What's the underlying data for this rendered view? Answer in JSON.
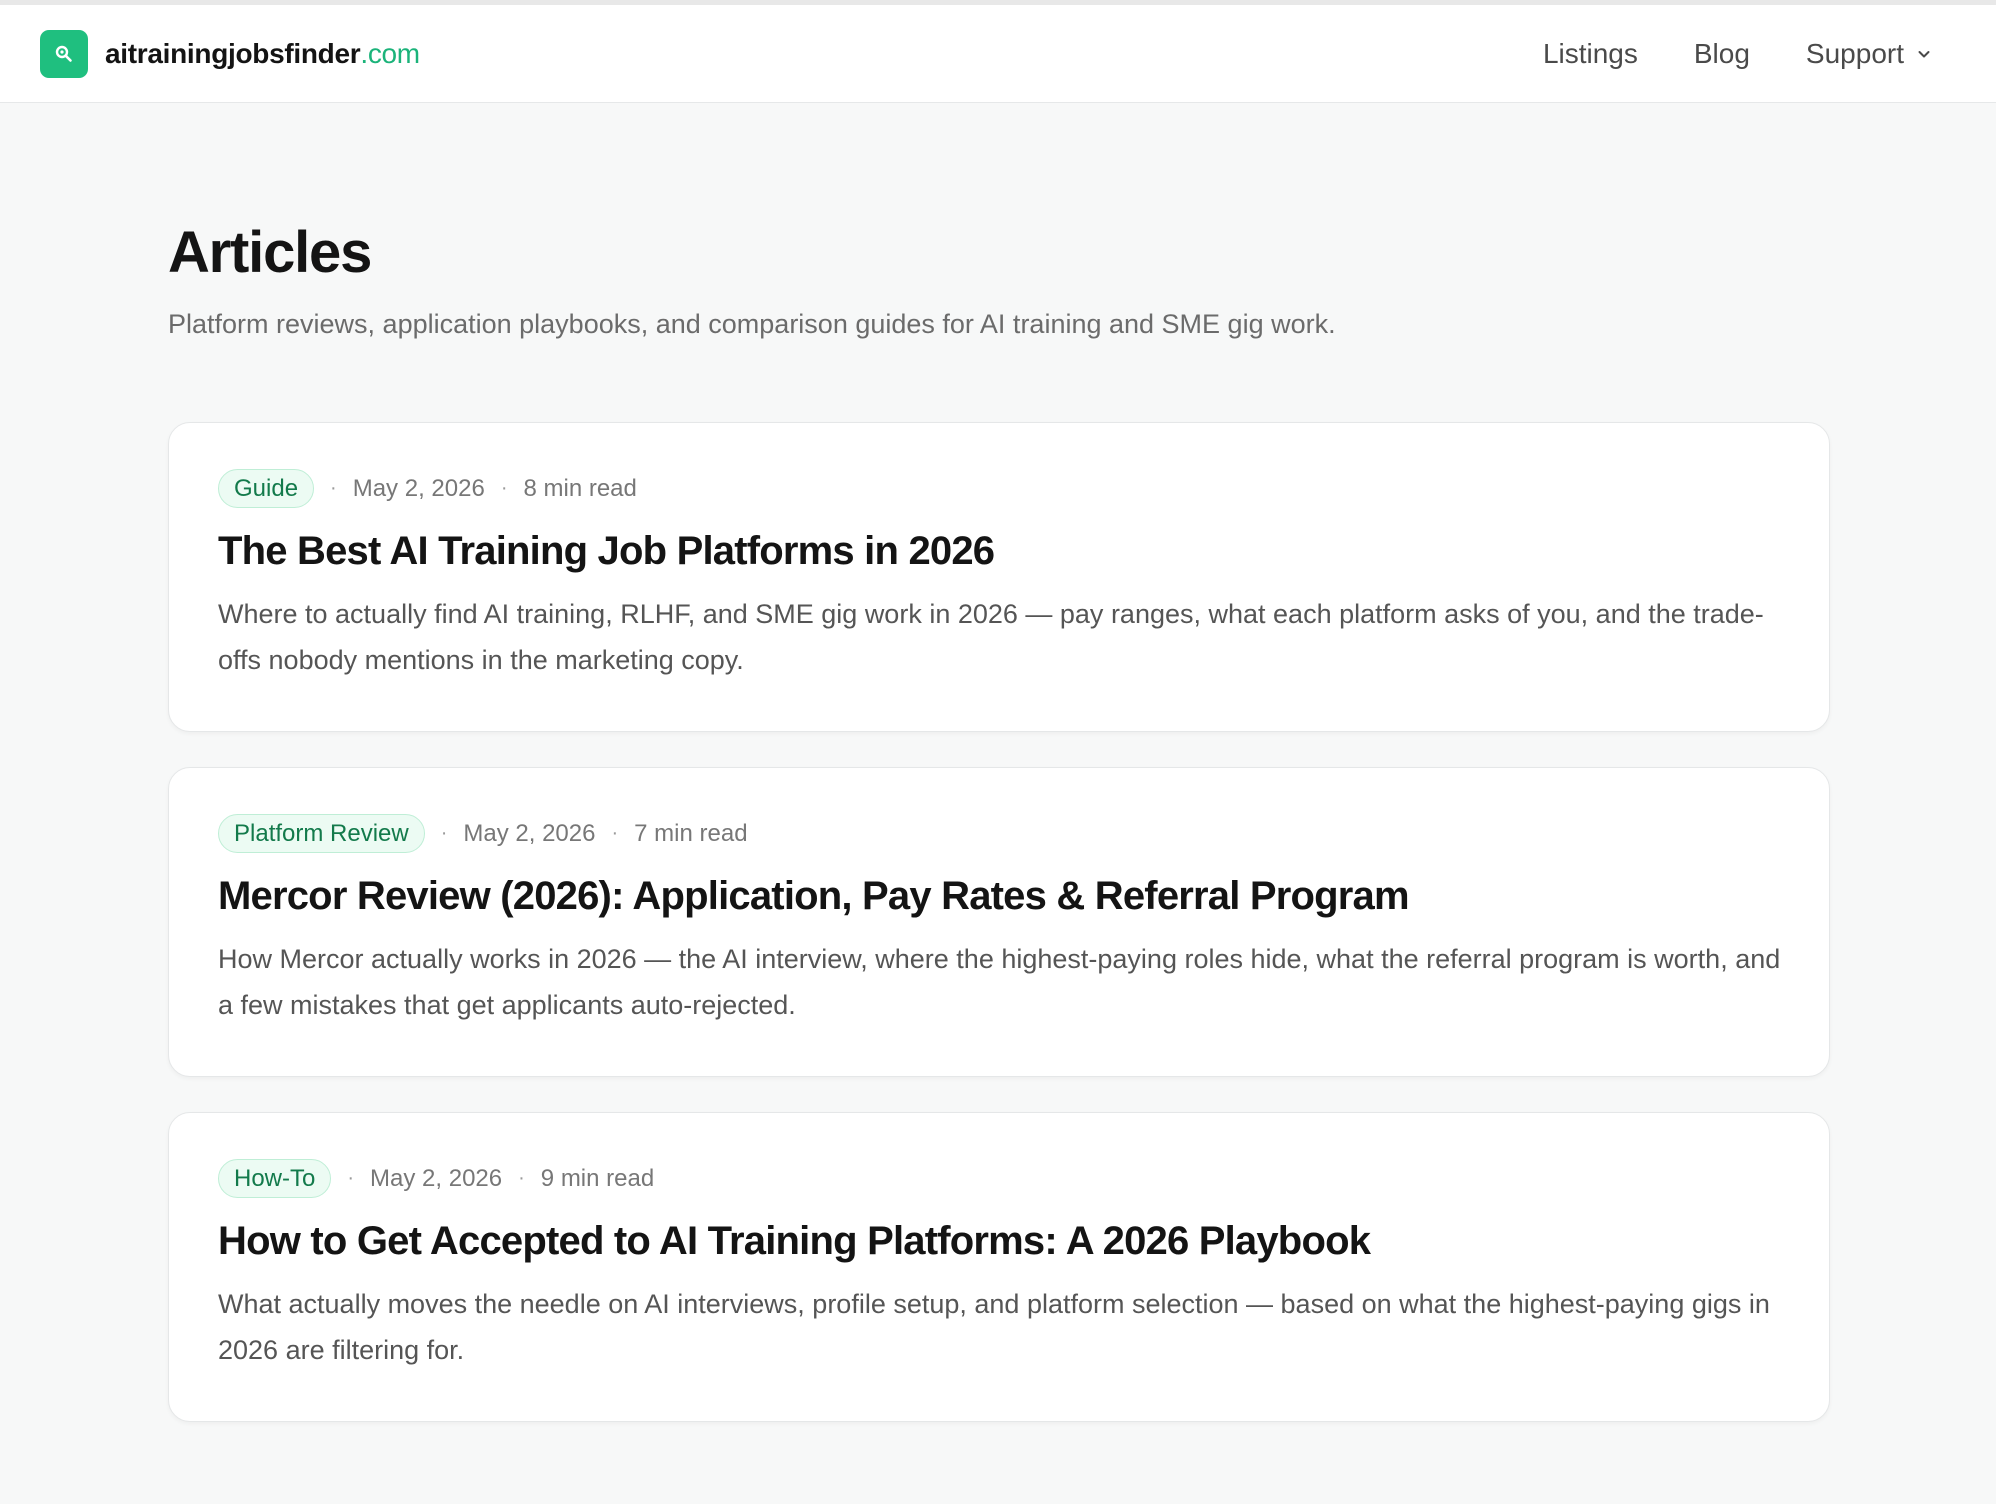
{
  "header": {
    "brand_name": "aitrainingjobsfinder",
    "brand_tld": ".com",
    "logo_icon": "search-icon",
    "accent_color": "#1fbf7f",
    "nav": {
      "listings": "Listings",
      "blog": "Blog",
      "support": "Support"
    }
  },
  "page": {
    "title": "Articles",
    "subtitle": "Platform reviews, application playbooks, and comparison guides for AI training and SME gig work."
  },
  "articles": [
    {
      "tag": "Guide",
      "date": "May 2, 2026",
      "read_time": "8 min read",
      "title": "The Best AI Training Job Platforms in 2026",
      "excerpt": "Where to actually find AI training, RLHF, and SME gig work in 2026 — pay ranges, what each platform asks of you, and the trade-offs nobody mentions in the marketing copy."
    },
    {
      "tag": "Platform Review",
      "date": "May 2, 2026",
      "read_time": "7 min read",
      "title": "Mercor Review (2026): Application, Pay Rates & Referral Program",
      "excerpt": "How Mercor actually works in 2026 — the AI interview, where the highest-paying roles hide, what the referral program is worth, and a few mistakes that get applicants auto-rejected."
    },
    {
      "tag": "How-To",
      "date": "May 2, 2026",
      "read_time": "9 min read",
      "title": "How to Get Accepted to AI Training Platforms: A 2026 Playbook",
      "excerpt": "What actually moves the needle on AI interviews, profile setup, and platform selection — based on what the highest-paying gigs in 2026 are filtering for."
    }
  ]
}
